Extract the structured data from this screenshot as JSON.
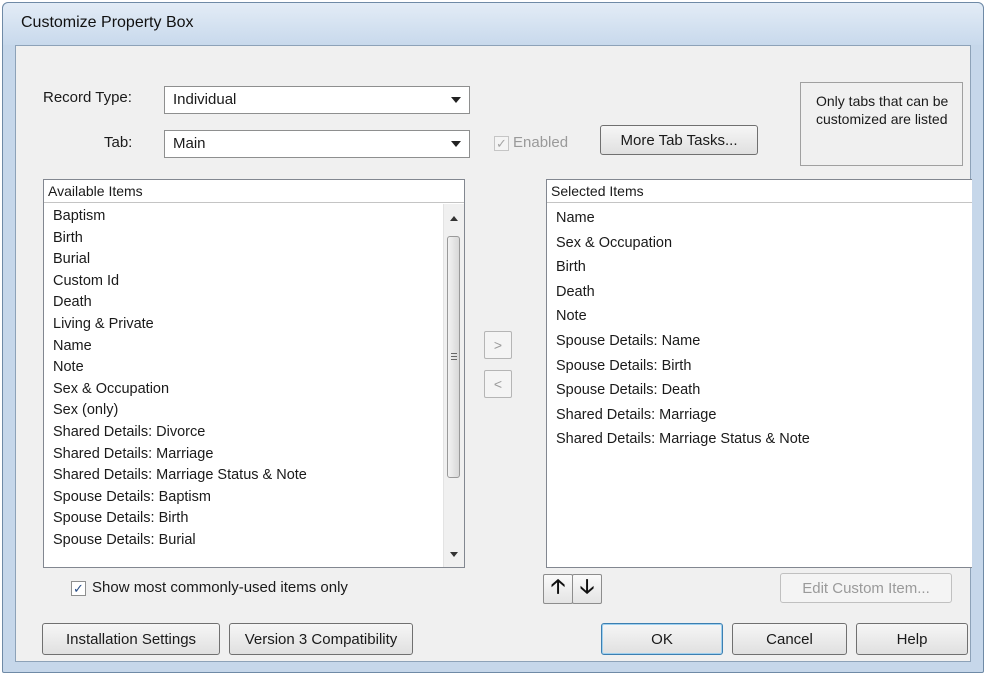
{
  "window": {
    "title": "Customize Property Box"
  },
  "form": {
    "record_type_label": "Record Type:",
    "record_type_value": "Individual",
    "tab_label": "Tab:",
    "tab_value": "Main",
    "enabled_label": "Enabled",
    "enabled_checked": true,
    "more_tab_tasks_label": "More Tab Tasks...",
    "info_text": "Only tabs that can be customized are listed"
  },
  "available": {
    "header": "Available Items",
    "items": [
      "Baptism",
      "Birth",
      "Burial",
      "Custom Id",
      "Death",
      "Living & Private",
      "Name",
      "Note",
      "Sex & Occupation",
      "Sex (only)",
      "Shared Details: Divorce",
      "Shared Details: Marriage",
      "Shared Details: Marriage Status & Note",
      "Spouse Details: Baptism",
      "Spouse Details: Birth",
      "Spouse Details: Burial"
    ]
  },
  "selected": {
    "header": "Selected Items",
    "items": [
      "Name",
      "Sex & Occupation",
      "Birth",
      "Death",
      "Note",
      "Spouse Details: Name",
      "Spouse Details: Birth",
      "Spouse Details: Death",
      "Shared Details: Marriage",
      "Shared Details: Marriage Status & Note"
    ]
  },
  "transfer": {
    "add_glyph": ">",
    "remove_glyph": "<"
  },
  "bottom": {
    "show_common_label": "Show most commonly-used items only",
    "show_common_checked": true,
    "move_up_glyph": "🡡",
    "move_down_glyph": "🡣",
    "edit_custom_label": "Edit Custom Item...",
    "installation_label": "Installation Settings",
    "version3_label": "Version 3 Compatibility",
    "ok_label": "OK",
    "cancel_label": "Cancel",
    "help_label": "Help"
  },
  "icons": {
    "check": "checkmark-icon",
    "dropdown": "chevron-down-icon",
    "up": "arrow-up-icon",
    "down": "arrow-down-icon"
  }
}
